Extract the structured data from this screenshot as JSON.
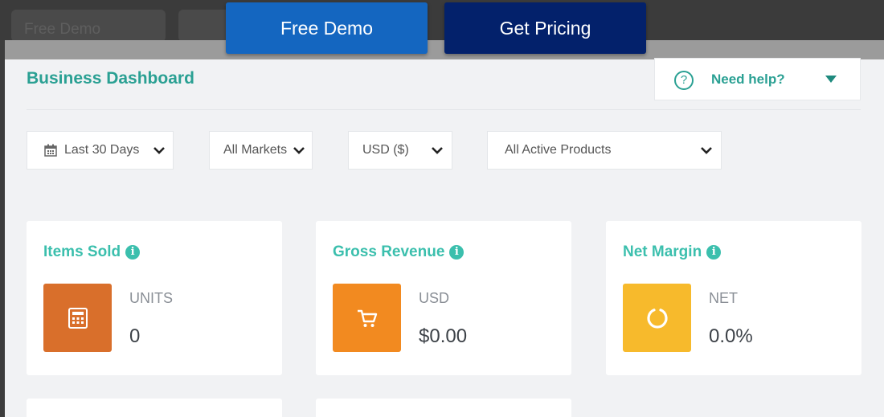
{
  "background": {
    "tab_text": "Free Demo"
  },
  "cta": {
    "demo_label": "Free Demo",
    "pricing_label": "Get Pricing"
  },
  "dashboard": {
    "title": "Business Dashboard",
    "help": {
      "icon_glyph": "?",
      "label": "Need help?"
    }
  },
  "filters": {
    "date_range": "Last 30 Days",
    "markets": "All Markets",
    "currency": "USD ($)",
    "products": "All Active Products"
  },
  "cards": [
    {
      "title": "Items Sold",
      "unit": "UNITS",
      "value": "0",
      "tile_color": "#d96f2b",
      "icon": "calculator-icon"
    },
    {
      "title": "Gross Revenue",
      "unit": "USD",
      "value": "$0.00",
      "tile_color": "#f28a20",
      "icon": "cart-icon"
    },
    {
      "title": "Net Margin",
      "unit": "NET",
      "value": "0.0%",
      "tile_color": "#f7ba2c",
      "icon": "ring-icon"
    }
  ],
  "colors": {
    "accent": "#2aa093",
    "card_title": "#3bbfad",
    "demo_button": "#1466c0",
    "pricing_button": "#03216b"
  }
}
